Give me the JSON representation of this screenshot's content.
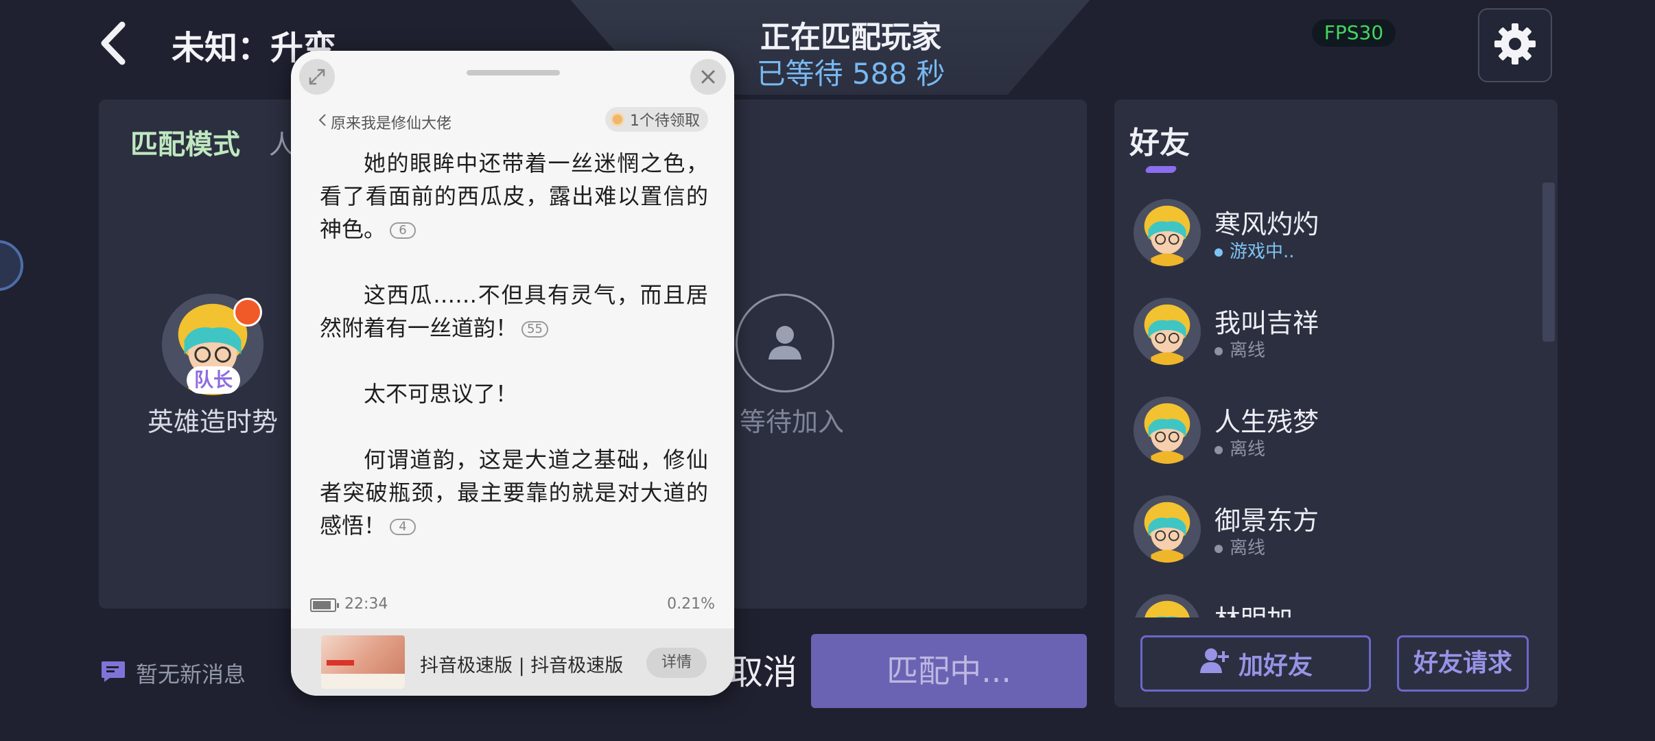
{
  "header": {
    "title": "未知：升变",
    "match_title": "正在匹配玩家",
    "match_wait": "已等待 588 秒",
    "fps": "FPS30"
  },
  "lobby": {
    "mode_label": "匹配模式",
    "mode_value": "人",
    "leader_badge": "队长",
    "player_name": "英雄造时势",
    "waiting_label": "等待加入"
  },
  "bottom": {
    "messages": "暂无新消息",
    "cancel": "取消",
    "matching": "匹配中..."
  },
  "friends": {
    "title": "好友",
    "items": [
      {
        "name": "寒风灼灼",
        "status": "游戏中.."
      },
      {
        "name": "我叫吉祥",
        "status": "离线"
      },
      {
        "name": "人生残梦",
        "status": "离线"
      },
      {
        "name": "御景东方",
        "status": "离线"
      },
      {
        "name": "林明加",
        "status": ""
      }
    ],
    "add_friend": "加好友",
    "friend_requests": "好友请求"
  },
  "reader": {
    "back_label": "原来我是修仙大佬",
    "reward": "1个待领取",
    "paragraphs": [
      {
        "text": "她的眼眸中还带着一丝迷惘之色，看了看面前的西瓜皮，露出难以置信的神色。",
        "comments": "6"
      },
      {
        "text": "这西瓜……不但具有灵气，而且居然附着有一丝道韵！",
        "comments": "55"
      },
      {
        "text": "太不可思议了！",
        "comments": ""
      },
      {
        "text": "何谓道韵，这是大道之基础，修仙者突破瓶颈，最主要靠的就是对大道的感悟！",
        "comments": "4"
      }
    ],
    "time": "22:34",
    "progress": "0.21%",
    "ad_title": "抖音极速版 | 抖音极速版",
    "ad_detail": "详情"
  },
  "colors": {
    "background": "#1f2130",
    "panel": "#2c2f40",
    "accent_purple": "#6a63b4",
    "fps_green": "#44d65e",
    "online_blue": "#7ec3f2"
  }
}
